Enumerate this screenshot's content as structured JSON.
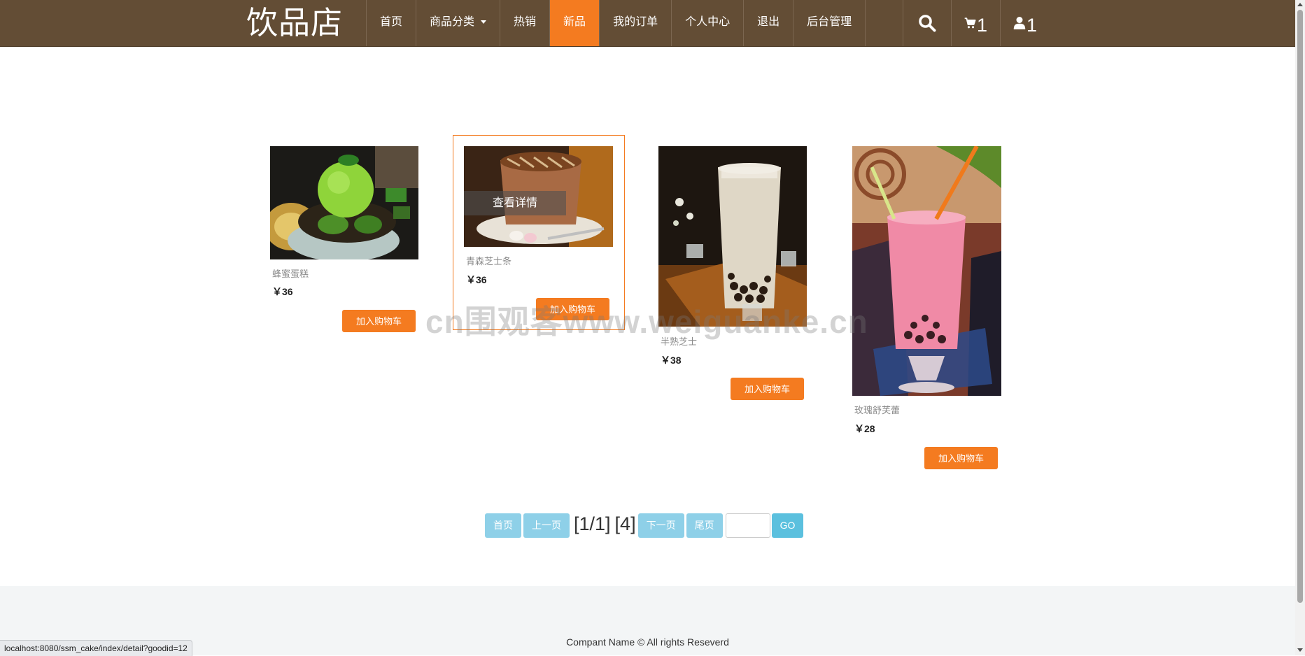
{
  "header": {
    "logo": "饮品店",
    "nav": [
      {
        "label": "首页"
      },
      {
        "label": "商品分类"
      },
      {
        "label": "热销"
      },
      {
        "label": "新品"
      },
      {
        "label": "我的订单"
      },
      {
        "label": "个人中心"
      },
      {
        "label": "退出"
      },
      {
        "label": "后台管理"
      }
    ],
    "active_nav": "新品",
    "icons": {
      "search": "search-icon",
      "cart": "cart-icon",
      "user": "user-icon"
    },
    "cart_count": "1",
    "user_count": "1"
  },
  "products": [
    {
      "name": "蜂蜜蛋糕",
      "price": "￥36",
      "button": "加入购物车",
      "image": "green-melon-ice-cream-sundae"
    },
    {
      "name": "青森芝士条",
      "price": "￥36",
      "button": "加入购物车",
      "image": "cocoa-drink-with-marshmallows",
      "overlay": "查看详情"
    },
    {
      "name": "半熟芝士",
      "price": "￥38",
      "button": "加入购物车",
      "image": "bubble-milk-tea-glass"
    },
    {
      "name": "玫瑰舒芙蕾",
      "price": "￥28",
      "button": "加入购物车",
      "image": "pink-bubble-tea-glass"
    }
  ],
  "pager": {
    "first": "首页",
    "prev": "上一页",
    "page_info": "[1/1]",
    "total": "[4]",
    "next": "下一页",
    "last": "尾页",
    "input_value": "",
    "go": "GO"
  },
  "footer": {
    "copyright": "Compant Name © All rights Reseverd"
  },
  "watermark": "cn围观客www.weiguanke.cn",
  "status_url": "localhost:8080/ssm_cake/index/detail?goodid=12",
  "colors": {
    "header": "#634d35",
    "accent": "#f47b20",
    "pager": "#8ed0e8",
    "go": "#5bc0de",
    "footer": "#f3f5f6"
  }
}
